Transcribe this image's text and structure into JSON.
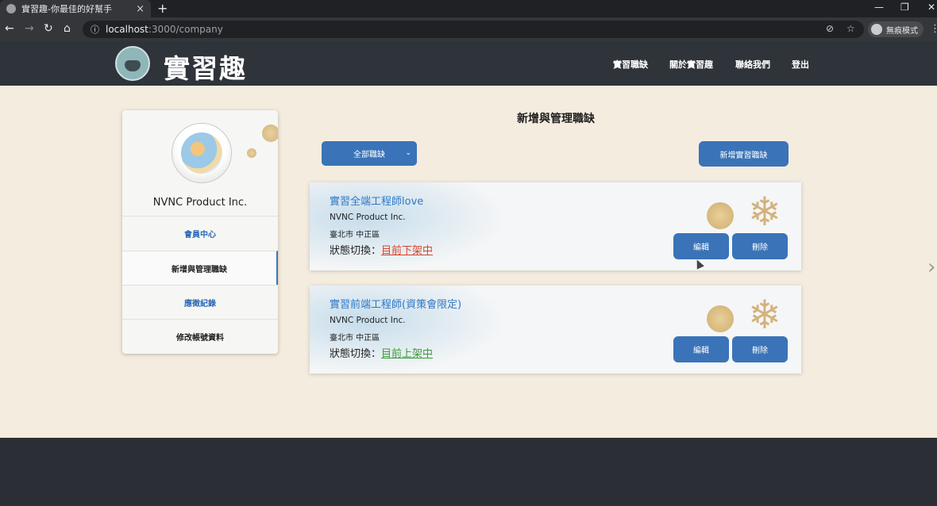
{
  "browser": {
    "tab_title": "實習趣-你最佳的好幫手",
    "tab_close": "×",
    "new_tab": "+",
    "url_host": "localhost",
    "url_path": ":3000/company",
    "profile_label": "無痕模式"
  },
  "header": {
    "logo_text": "實習趣",
    "nav": [
      "實習職缺",
      "關於實習趣",
      "聯絡我們",
      "登出"
    ]
  },
  "sidebar": {
    "company_name": "NVNC Product Inc.",
    "items": [
      {
        "label": "會員中心"
      },
      {
        "label": "新增與管理職缺"
      },
      {
        "label": "應徵紀錄"
      },
      {
        "label": "修改帳號資料"
      }
    ]
  },
  "main": {
    "title": "新增與管理職缺",
    "filter_label": "全部職缺",
    "add_button": "新增實習職缺"
  },
  "jobs": [
    {
      "title": "實習全端工程師love",
      "company": "NVNC Product Inc.",
      "location": "臺北市 中正區",
      "status_prefix": "狀態切換：",
      "status_link": "目前下架中",
      "edit": "編輯",
      "delete": "刪除"
    },
    {
      "title": "實習前端工程師(資策會限定)",
      "company": "NVNC Product Inc.",
      "location": "臺北市 中正區",
      "status_prefix": "狀態切換：",
      "status_link": "目前上架中",
      "edit": "編輯",
      "delete": "刪除"
    }
  ],
  "colors": {
    "primary": "#3a73b8",
    "link_blue": "#2f79c6",
    "status_off": "#d9452d",
    "status_on": "#3c9b3a",
    "page_bg": "#f4ecdf",
    "header_bg": "#2f343a"
  }
}
